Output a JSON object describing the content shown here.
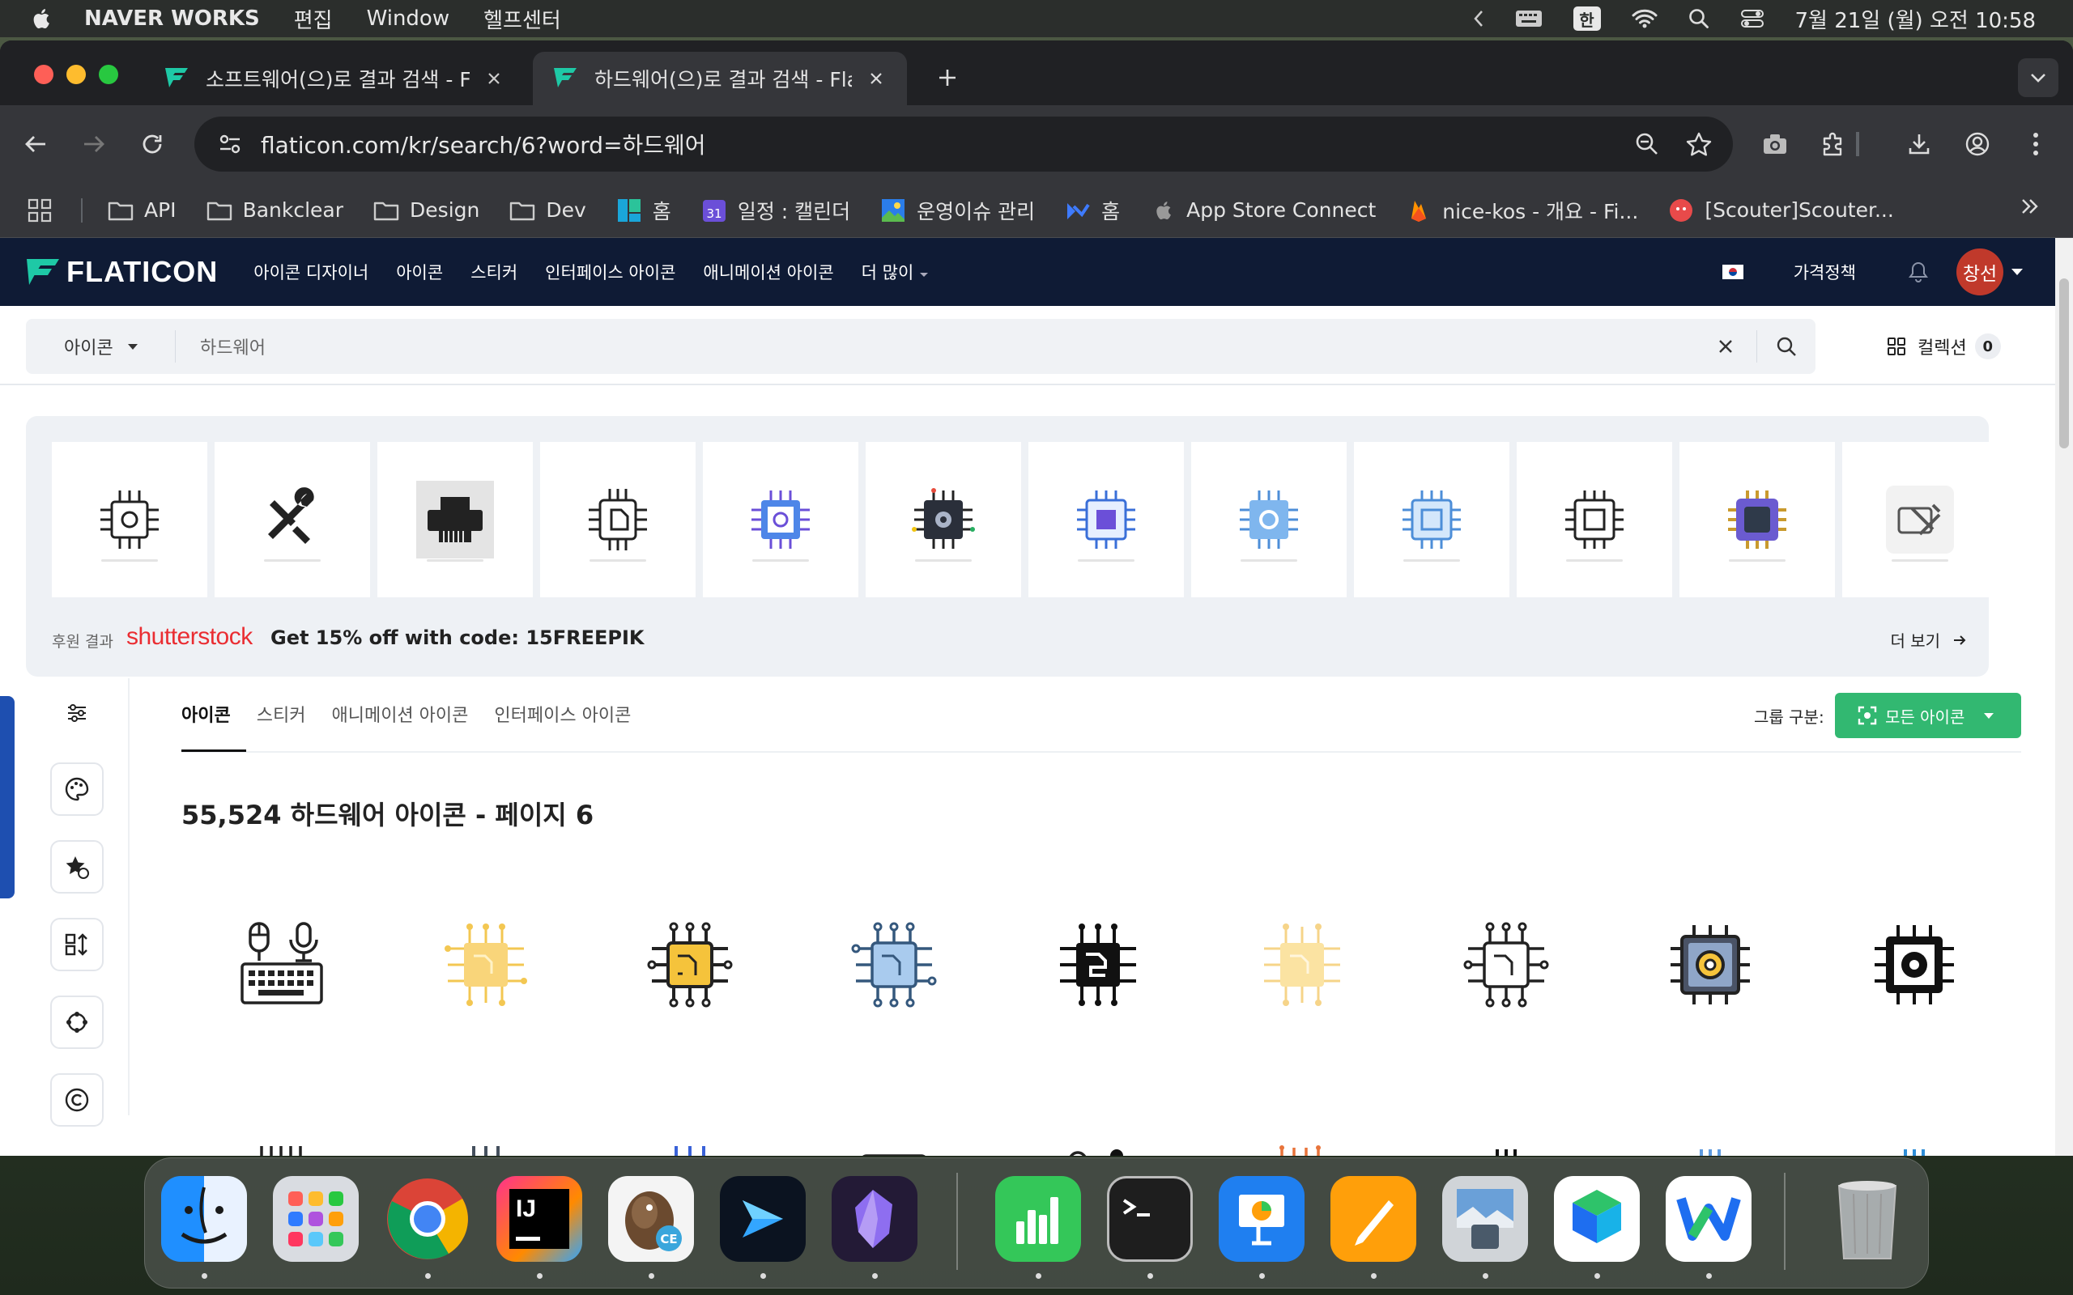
{
  "menubar": {
    "app": "NAVER WORKS",
    "menus": [
      "편집",
      "Window",
      "헬프센터"
    ],
    "ime": "한",
    "clock": "7월 21일 (월) 오전 10:58"
  },
  "browser": {
    "tabs": [
      {
        "title": "소프트웨어(으)로 결과 검색 - Flati"
      },
      {
        "title": "하드웨어(으)로 결과 검색 - Flatic"
      }
    ],
    "url": "flaticon.com/kr/search/6?word=하드웨어",
    "bookmarks": [
      "API",
      "Bankclear",
      "Design",
      "Dev",
      "홈",
      "일정 : 캘린더",
      "운영이슈 관리",
      "홈",
      "App Store Connect",
      "nice-kos - 개요 - Fi...",
      "[Scouter]Scouter..."
    ],
    "calendar_day": "31"
  },
  "flaticon": {
    "logo": "FLATICON",
    "nav": [
      "아이콘 디자이너",
      "아이콘",
      "스티커",
      "인터페이스 아이콘",
      "애니메이션 아이콘",
      "더 많이"
    ],
    "pricing": "가격정책",
    "avatar": "창선",
    "search_type": "아이콘",
    "search_query": "하드웨어",
    "collection_label": "컬렉션",
    "collection_count": "0"
  },
  "sponsored": {
    "label": "후원 결과",
    "brand": "shutterstock",
    "promo": "Get 15% off with code: 15FREEPIK",
    "more": "더 보기",
    "cards": [
      "chip-gear-outline",
      "wrench-screwdriver",
      "printer",
      "microchip-outline",
      "chip-gear-purple",
      "chip-gear-dark",
      "chip-circuit-blue",
      "chip-gear-lightblue",
      "chip-circuit-lightblue",
      "chip-circuit-black",
      "processor-gold",
      "tools-gray"
    ]
  },
  "content": {
    "tabs": [
      "아이콘",
      "스티커",
      "애니메이션 아이콘",
      "인터페이스 아이콘"
    ],
    "group_by": "그룹 구분:",
    "all_icons": "모든 아이콘",
    "result_title": "55,524 하드웨어 아이콘 - 페이지 6",
    "icons": [
      "keyboard-mouse-mic",
      "chip-yellow-light",
      "chip-yellow-black",
      "chip-blue",
      "chip-black-fill",
      "chip-yellow-faded",
      "chip-outline",
      "processor-gear-color",
      "processor-gear-black"
    ]
  },
  "colors": {
    "nav_bg": "#0f1b35",
    "accent_green": "#32b871",
    "brand_red": "#ea2d32"
  }
}
